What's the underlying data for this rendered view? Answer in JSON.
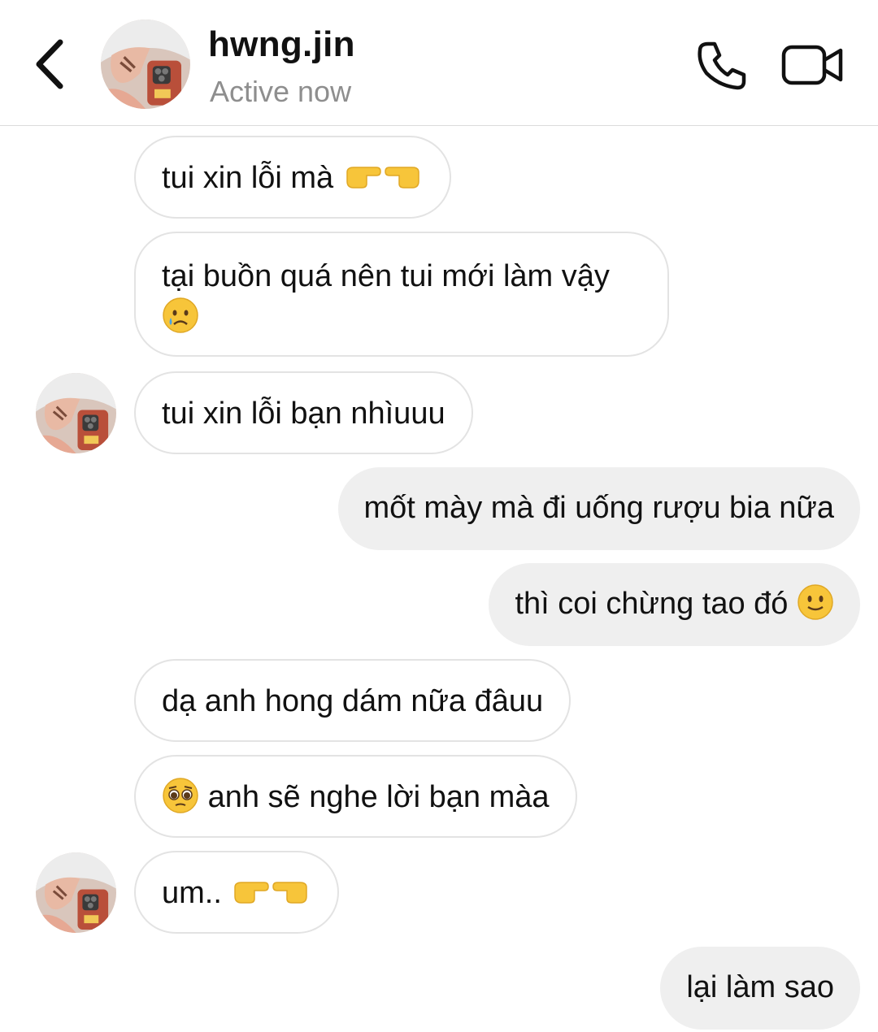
{
  "header": {
    "contact_name": "hwng.jin",
    "status": "Active now",
    "back_icon": "chevron-left-icon",
    "call_icon": "phone-icon",
    "video_icon": "video-camera-icon"
  },
  "messages": [
    {
      "side": "incoming",
      "text": "tui xin lỗi mà",
      "emoji": "pointing-fingers"
    },
    {
      "side": "incoming",
      "text": "tại buồn quá nên tui mới làm vậy",
      "emoji": "crying-face"
    },
    {
      "side": "incoming",
      "text": "tui xin lỗi bạn nhìuuu",
      "show_avatar": true
    },
    {
      "side": "outgoing",
      "text": "mốt mày mà đi uống rượu bia nữa"
    },
    {
      "side": "outgoing",
      "text": "thì coi chừng tao đó",
      "emoji": "slightly-smiling-face"
    },
    {
      "side": "incoming",
      "text": "dạ anh hong dám nữa đâuu"
    },
    {
      "side": "incoming",
      "text": "anh sẽ nghe lời bạn màa",
      "emoji_before": "pleading-face"
    },
    {
      "side": "incoming",
      "text": "um..",
      "emoji": "pointing-fingers",
      "show_avatar": true
    },
    {
      "side": "outgoing",
      "text": "lại làm sao"
    }
  ],
  "colors": {
    "incoming_border": "#e3e3e3",
    "outgoing_bg": "#efefef",
    "status_gray": "#8e8e8e",
    "emoji_yellow": "#f7c53a"
  }
}
